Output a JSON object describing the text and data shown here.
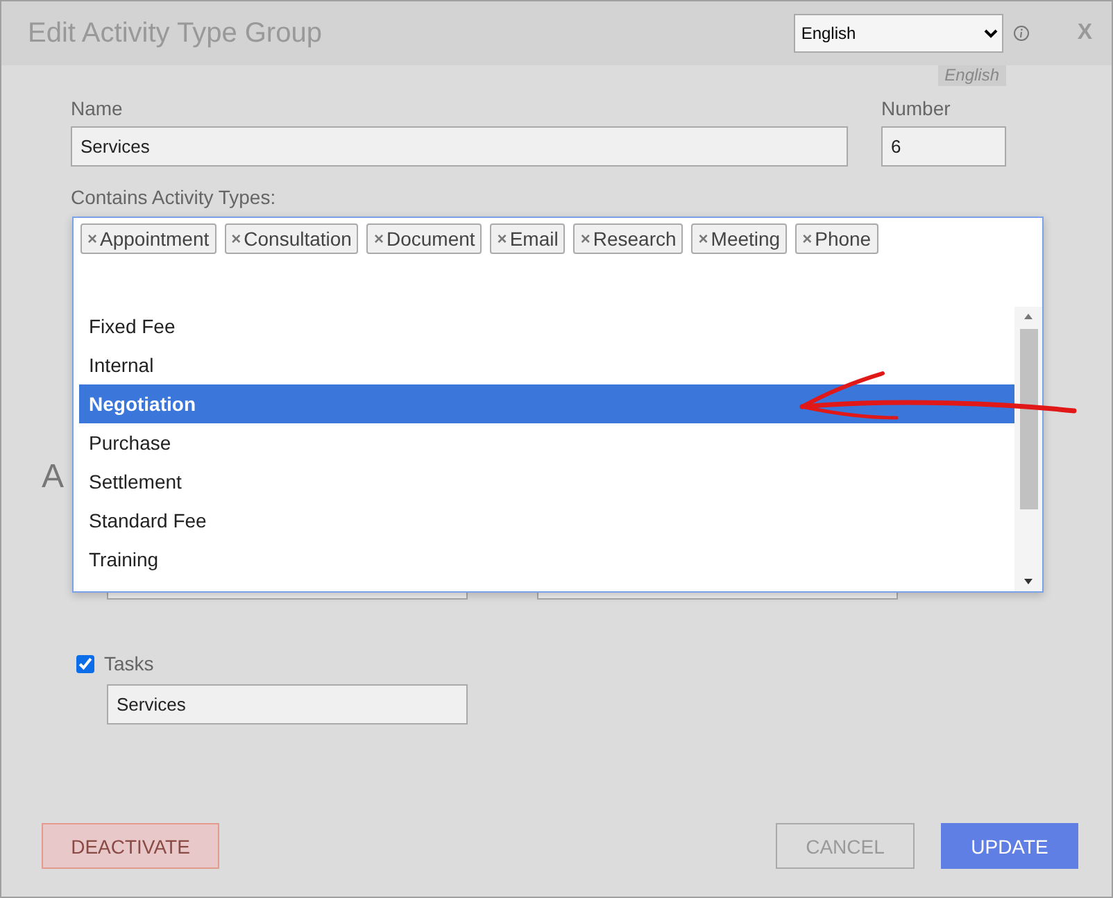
{
  "window": {
    "title": "Edit Activity Type Group",
    "close": "X"
  },
  "language": {
    "value": "English",
    "badge": "English"
  },
  "name": {
    "label": "Name",
    "value": "Services"
  },
  "number": {
    "label": "Number",
    "value": "6"
  },
  "contains": {
    "label": "Contains Activity Types:",
    "tags": [
      {
        "remove": "×",
        "label": "Appointment"
      },
      {
        "remove": "×",
        "label": "Consultation"
      },
      {
        "remove": "×",
        "label": "Document"
      },
      {
        "remove": "×",
        "label": "Email"
      },
      {
        "remove": "×",
        "label": "Research"
      },
      {
        "remove": "×",
        "label": "Meeting"
      },
      {
        "remove": "×",
        "label": "Phone"
      }
    ],
    "options": [
      {
        "label": "Fixed Fee",
        "selected": false
      },
      {
        "label": "Internal",
        "selected": false
      },
      {
        "label": "Negotiation",
        "selected": true
      },
      {
        "label": "Purchase",
        "selected": false
      },
      {
        "label": "Settlement",
        "selected": false
      },
      {
        "label": "Standard Fee",
        "selected": false
      },
      {
        "label": "Training",
        "selected": false
      }
    ]
  },
  "section": {
    "heading": "A"
  },
  "tasks": {
    "label": "Tasks",
    "checked": true,
    "value": "Services"
  },
  "buttons": {
    "deactivate": "DEACTIVATE",
    "cancel": "CANCEL",
    "update": "UPDATE"
  }
}
